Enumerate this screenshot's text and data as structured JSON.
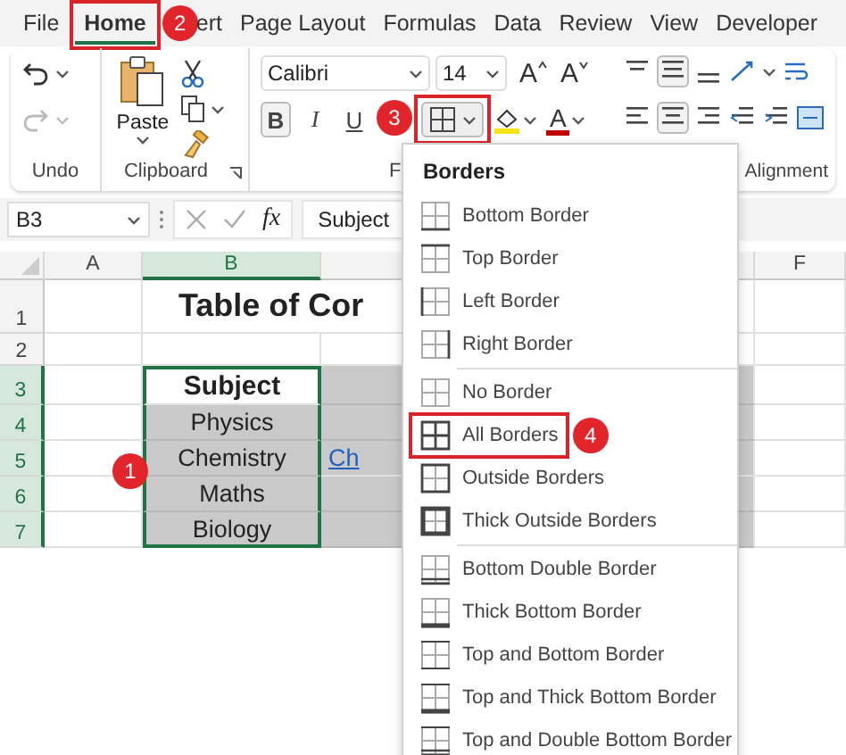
{
  "tabs": [
    {
      "label": "File",
      "selected": false
    },
    {
      "label": "Home",
      "selected": true,
      "highlighted": true,
      "callout": "2"
    },
    {
      "label": "ert",
      "selected": false
    },
    {
      "label": "Page Layout",
      "selected": false
    },
    {
      "label": "Formulas",
      "selected": false
    },
    {
      "label": "Data",
      "selected": false
    },
    {
      "label": "Review",
      "selected": false
    },
    {
      "label": "View",
      "selected": false
    },
    {
      "label": "Developer",
      "selected": false
    }
  ],
  "ribbon": {
    "groups": [
      {
        "kind": "undo",
        "label": "Undo"
      },
      {
        "kind": "clipboard",
        "label": "Clipboard",
        "paste_label": "Paste"
      },
      {
        "kind": "font",
        "label": "F",
        "font": "Calibri",
        "size": "14",
        "size_buttons": [
          "A",
          "A"
        ],
        "font_color_label": "A",
        "format_buttons": [
          {
            "label": "B",
            "kind": "bold",
            "selected": true
          },
          {
            "label": "I",
            "kind": "italic",
            "selected": false
          },
          {
            "label": "U",
            "kind": "underline",
            "selected": false
          }
        ],
        "borders_button": {
          "highlighted": true,
          "callout": "3"
        }
      },
      {
        "kind": "alignment",
        "label": "Alignment"
      }
    ]
  },
  "formula_bar": {
    "name_box": "B3",
    "function_label": "fx",
    "value": "Subject"
  },
  "sheet": {
    "callout": "1",
    "columns": [
      {
        "label": "A",
        "selected": false
      },
      {
        "label": "B",
        "selected": true
      },
      {
        "label": "F",
        "selected": false
      }
    ],
    "rows": [
      {
        "header": "1",
        "selected": false,
        "title": "Table of Cor"
      },
      {
        "header": "2",
        "selected": false
      },
      {
        "header": "3",
        "selected": true,
        "b": {
          "text": "Subject",
          "kind": "heading"
        },
        "c": {
          "kind": "shaded"
        }
      },
      {
        "header": "4",
        "selected": true,
        "b": {
          "text": "Physics",
          "kind": "shaded"
        },
        "c": {
          "kind": "shaded"
        }
      },
      {
        "header": "5",
        "selected": true,
        "b": {
          "text": "Chemistry",
          "kind": "shaded"
        },
        "c": {
          "text": "Ch",
          "kind": "link"
        }
      },
      {
        "header": "6",
        "selected": true,
        "b": {
          "text": "Maths",
          "kind": "shaded"
        },
        "c": {
          "kind": "shaded"
        }
      },
      {
        "header": "7",
        "selected": true,
        "b": {
          "text": "Biology",
          "kind": "shaded"
        },
        "c": {
          "kind": "shaded"
        }
      }
    ]
  },
  "borders_menu": {
    "title": "Borders",
    "sections": [
      [
        {
          "label": "Bottom Border",
          "kind": "bottom",
          "highlighted": false
        },
        {
          "label": "Top Border",
          "kind": "top",
          "highlighted": false
        },
        {
          "label": "Left Border",
          "kind": "left",
          "highlighted": false
        },
        {
          "label": "Right Border",
          "kind": "right",
          "highlighted": false
        }
      ],
      [
        {
          "label": "No Border",
          "kind": "none",
          "highlighted": false
        },
        {
          "label": "All Borders",
          "kind": "all",
          "highlighted": true,
          "callout": "4"
        },
        {
          "label": "Outside Borders",
          "kind": "outside",
          "highlighted": false
        },
        {
          "label": "Thick Outside Borders",
          "kind": "thick-outside",
          "highlighted": false
        }
      ],
      [
        {
          "label": "Bottom Double Border",
          "kind": "bottom-double",
          "highlighted": false
        },
        {
          "label": "Thick Bottom Border",
          "kind": "thick-bottom",
          "highlighted": false
        },
        {
          "label": "Top and Bottom Border",
          "kind": "top-bottom",
          "highlighted": false
        },
        {
          "label": "Top and Thick Bottom Border",
          "kind": "top-thick-bottom",
          "highlighted": false
        },
        {
          "label": "Top and Double Bottom Border",
          "kind": "top-double-bottom",
          "highlighted": false
        }
      ]
    ]
  }
}
